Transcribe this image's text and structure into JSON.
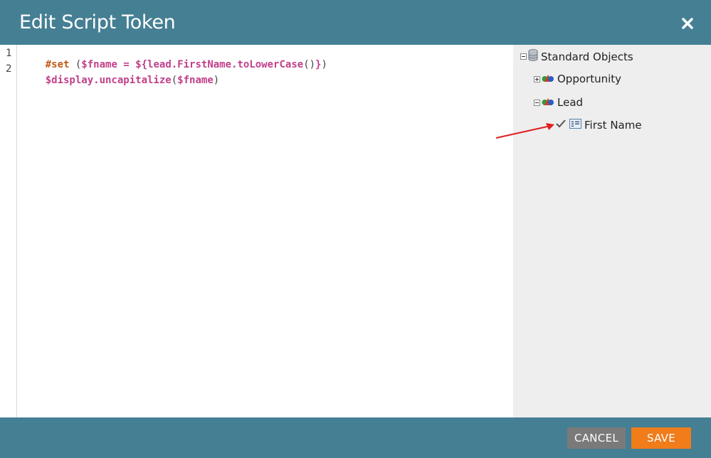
{
  "dialog": {
    "title": "Edit Script Token",
    "close_icon": "close-icon",
    "colors": {
      "header": "#457f93",
      "save": "#f07c1a",
      "cancel": "#7a7a7a"
    }
  },
  "editor": {
    "line_numbers": [
      "1",
      "2"
    ],
    "lines": [
      {
        "tokens": [
          {
            "text": "#set",
            "kind": "kw"
          },
          {
            "text": " (",
            "kind": "punc"
          },
          {
            "text": "$fname",
            "kind": "var"
          },
          {
            "text": " = ",
            "kind": "var"
          },
          {
            "text": "${lead.FirstName.toLowerCase",
            "kind": "var"
          },
          {
            "text": "()",
            "kind": "punc"
          },
          {
            "text": "}",
            "kind": "var"
          },
          {
            "text": ")",
            "kind": "punc"
          }
        ]
      },
      {
        "tokens": [
          {
            "text": "$display.uncapitalize",
            "kind": "var"
          },
          {
            "text": "(",
            "kind": "punc"
          },
          {
            "text": "$fname",
            "kind": "var"
          },
          {
            "text": ")",
            "kind": "punc"
          }
        ]
      }
    ]
  },
  "tree": {
    "root": {
      "label": "Standard Objects",
      "icon": "database-icon"
    },
    "opportunity": {
      "label": "Opportunity",
      "icon": "object-icon"
    },
    "lead": {
      "label": "Lead",
      "icon": "object-icon"
    },
    "first_name": {
      "label": "First Name",
      "icon": "field-icon"
    }
  },
  "footer": {
    "cancel_label": "CANCEL",
    "save_label": "SAVE"
  }
}
